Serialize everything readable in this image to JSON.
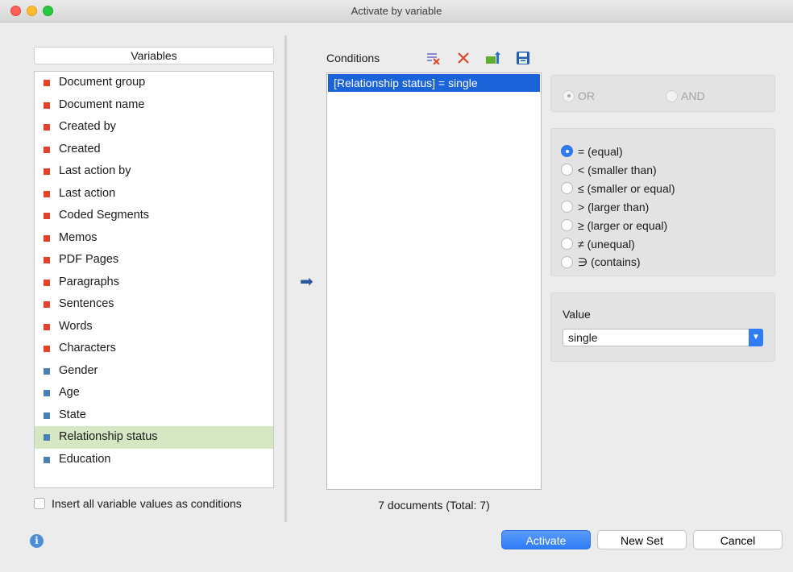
{
  "window": {
    "title": "Activate by variable"
  },
  "variables": {
    "header": "Variables",
    "items": [
      {
        "label": "Document group",
        "kind": "system"
      },
      {
        "label": "Document name",
        "kind": "system"
      },
      {
        "label": "Created by",
        "kind": "system"
      },
      {
        "label": "Created",
        "kind": "system"
      },
      {
        "label": "Last action by",
        "kind": "system"
      },
      {
        "label": "Last action",
        "kind": "system"
      },
      {
        "label": "Coded Segments",
        "kind": "system"
      },
      {
        "label": "Memos",
        "kind": "system"
      },
      {
        "label": "PDF Pages",
        "kind": "system"
      },
      {
        "label": "Paragraphs",
        "kind": "system"
      },
      {
        "label": "Sentences",
        "kind": "system"
      },
      {
        "label": "Words",
        "kind": "system"
      },
      {
        "label": "Characters",
        "kind": "system"
      },
      {
        "label": "Gender",
        "kind": "user"
      },
      {
        "label": "Age",
        "kind": "user"
      },
      {
        "label": "State",
        "kind": "user"
      },
      {
        "label": "Relationship status",
        "kind": "user",
        "selected": true
      },
      {
        "label": "Education",
        "kind": "user"
      }
    ],
    "insert_all_label": "Insert all variable values as conditions",
    "insert_all_checked": false
  },
  "conditions": {
    "label": "Conditions",
    "items": [
      "[Relationship status] = single"
    ],
    "doc_count": "7 documents (Total: 7)",
    "toolbar": [
      "clear-conditions-icon",
      "delete-icon",
      "export-icon",
      "save-icon"
    ]
  },
  "logic": {
    "options": [
      "OR",
      "AND"
    ],
    "selected": "OR",
    "disabled": true
  },
  "operators": {
    "options": [
      "= (equal)",
      "< (smaller than)",
      "≤ (smaller or equal)",
      "> (larger than)",
      "≥ (larger or equal)",
      "≠ (unequal)",
      "∋ (contains)"
    ],
    "selected_index": 0
  },
  "value": {
    "label": "Value",
    "selected": "single"
  },
  "buttons": {
    "activate": "Activate",
    "new_set": "New Set",
    "cancel": "Cancel"
  },
  "colors": {
    "system_variable": "#e0432b",
    "user_variable": "#4a81b5",
    "selection": "#1a63d9",
    "accent": "#2f7cf6"
  }
}
